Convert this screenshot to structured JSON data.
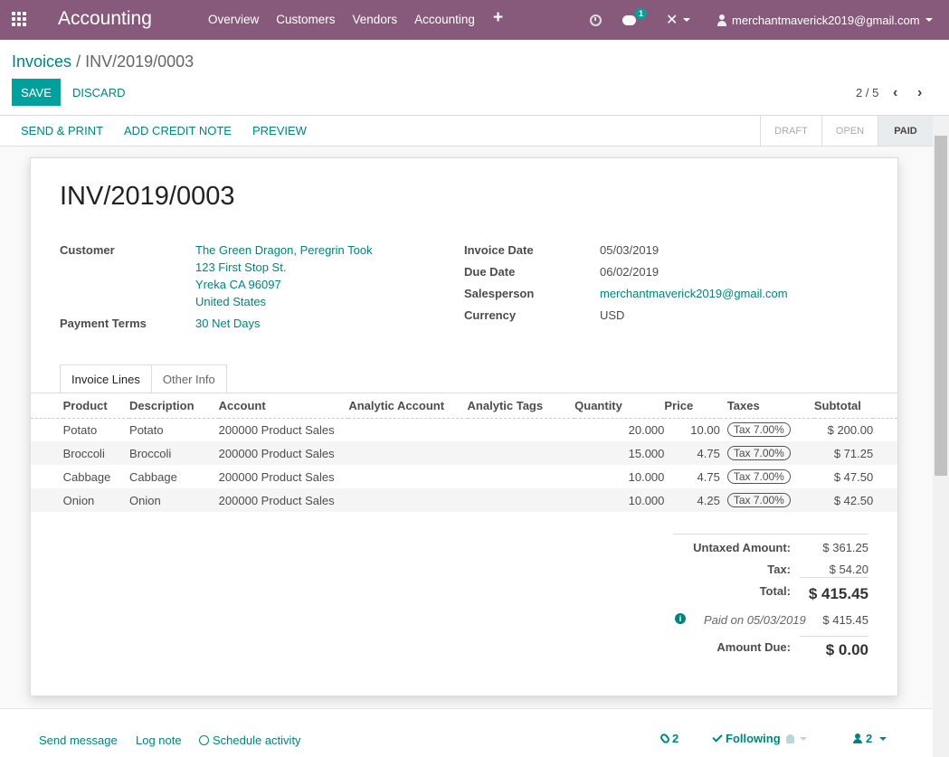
{
  "navbar": {
    "app_name": "Accounting",
    "menu": [
      "Overview",
      "Customers",
      "Vendors",
      "Accounting"
    ],
    "plus_icon": "+",
    "chat_badge": "1",
    "tools_icon": "✕",
    "user_email": "merchantmaverick2019@gmail.com"
  },
  "breadcrumb": {
    "parent": "Invoices",
    "separator": "/",
    "current": "INV/2019/0003"
  },
  "buttons": {
    "save": "SAVE",
    "discard": "DISCARD"
  },
  "pager": {
    "text": "2 / 5",
    "prev": "‹",
    "next": "›"
  },
  "status_actions": [
    "SEND & PRINT",
    "ADD CREDIT NOTE",
    "PREVIEW"
  ],
  "stages": [
    "DRAFT",
    "OPEN",
    "PAID"
  ],
  "invoice": {
    "number": "INV/2019/0003",
    "customer_label": "Customer",
    "customer_lines": [
      "The Green Dragon, Peregrin Took",
      "123 First Stop St.",
      "Yreka CA 96097",
      "United States"
    ],
    "payment_terms_label": "Payment Terms",
    "payment_terms": "30 Net Days",
    "invoice_date_label": "Invoice Date",
    "invoice_date": "05/03/2019",
    "due_date_label": "Due Date",
    "due_date": "06/02/2019",
    "salesperson_label": "Salesperson",
    "salesperson": "merchantmaverick2019@gmail.com",
    "currency_label": "Currency",
    "currency": "USD"
  },
  "tabs": [
    "Invoice Lines",
    "Other Info"
  ],
  "lines": {
    "headers": [
      "Product",
      "Description",
      "Account",
      "Analytic Account",
      "Analytic Tags",
      "Quantity",
      "Price",
      "Taxes",
      "Subtotal"
    ],
    "rows": [
      {
        "product": "Potato",
        "description": "Potato",
        "account": "200000 Product Sales",
        "quantity": "20.000",
        "price": "10.00",
        "tax": "Tax 7.00%",
        "subtotal": "$ 200.00"
      },
      {
        "product": "Broccoli",
        "description": "Broccoli",
        "account": "200000 Product Sales",
        "quantity": "15.000",
        "price": "4.75",
        "tax": "Tax 7.00%",
        "subtotal": "$ 71.25"
      },
      {
        "product": "Cabbage",
        "description": "Cabbage",
        "account": "200000 Product Sales",
        "quantity": "10.000",
        "price": "4.75",
        "tax": "Tax 7.00%",
        "subtotal": "$ 47.50"
      },
      {
        "product": "Onion",
        "description": "Onion",
        "account": "200000 Product Sales",
        "quantity": "10.000",
        "price": "4.25",
        "tax": "Tax 7.00%",
        "subtotal": "$ 42.50"
      }
    ]
  },
  "totals": {
    "untaxed_label": "Untaxed Amount:",
    "untaxed": "$ 361.25",
    "tax_label": "Tax:",
    "tax": "$ 54.20",
    "total_label": "Total:",
    "total": "$ 415.45",
    "paid_on": "Paid on 05/03/2019",
    "paid_amount": "$ 415.45",
    "amount_due_label": "Amount Due:",
    "amount_due": "$ 0.00"
  },
  "chatter": {
    "send_message": "Send message",
    "log_note": "Log note",
    "schedule_activity": "Schedule activity",
    "attachments": "2",
    "following": "Following",
    "followers": "2"
  },
  "colors": {
    "navbar": "#875a7b",
    "primary": "#00a09d",
    "link": "#00827f"
  }
}
